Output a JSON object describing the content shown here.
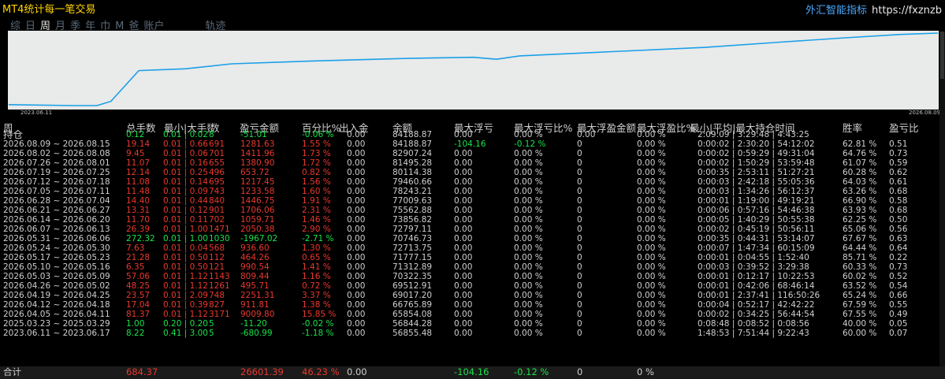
{
  "app": {
    "title": "MT4统计每一笔交易",
    "brand_cn": "外汇智能指标",
    "brand_url": "https://fxznzb"
  },
  "tabs": [
    "综",
    "日",
    "周",
    "月",
    "季",
    "年",
    "巾",
    "M",
    "爸",
    "账户",
    "轨迹"
  ],
  "active_tab": 2,
  "chart": {
    "start_label": "2023.06.11",
    "end_label": "2026.08.09",
    "line_color": "#1aa0e8",
    "points": [
      [
        0,
        54720
      ],
      [
        0.07,
        54300
      ],
      [
        0.095,
        54300
      ],
      [
        0.11,
        56200
      ],
      [
        0.14,
        69800
      ],
      [
        0.19,
        70600
      ],
      [
        0.24,
        72800
      ],
      [
        0.33,
        74100
      ],
      [
        0.43,
        75200
      ],
      [
        0.5,
        75700
      ],
      [
        0.525,
        74800
      ],
      [
        0.55,
        76300
      ],
      [
        0.65,
        78200
      ],
      [
        0.75,
        80100
      ],
      [
        0.83,
        82400
      ],
      [
        0.9,
        84300
      ],
      [
        0.96,
        85800
      ],
      [
        1,
        86400
      ]
    ]
  },
  "headers": [
    "周",
    "总手数",
    "最小|大手数",
    "数",
    "盈亏金额",
    "百分比%",
    "出入金",
    "余额",
    "最大浮亏",
    "最大浮亏比%",
    "最大浮盈金额",
    "最大浮盈比%",
    "最小|平均|最大持仓时间",
    "胜率",
    "盈亏比"
  ],
  "subheader": {
    "label": "持仓",
    "cells": [
      "0.12",
      "0.01 | 0.02",
      "8",
      "-51.01",
      "-0.06 %",
      "0.00",
      "84188.87",
      "0.00",
      "0.00 %",
      "0.00",
      "0.00 %",
      "2:09:09 | 3:29:48 | 4:43:25",
      "",
      ""
    ]
  },
  "rows": [
    {
      "c": "r",
      "v": [
        "2026.08.09 ~ 2026.08.15",
        "19.14",
        "0.01 | 0.66",
        "691",
        "1281.63",
        "1.55 %",
        "0.00",
        "84188.87",
        "-104.16",
        "-0.12 %",
        "0",
        "0.00 %",
        "0:00:02 | 2:30:20 | 54:12:02",
        "62.81 %",
        "0.51"
      ]
    },
    {
      "c": "r",
      "v": [
        "2026.08.02 ~ 2026.08.08",
        "9.45",
        "0.01 | 0.06",
        "701",
        "1411.96",
        "1.73 %",
        "0.00",
        "82907.24",
        "0.00",
        "0.00 %",
        "0",
        "0.00 %",
        "0:00:02 | 0:59:29 | 49:31:04",
        "64.76 %",
        "0.73"
      ]
    },
    {
      "c": "r",
      "v": [
        "2026.07.26 ~ 2026.08.01",
        "11.07",
        "0.01 | 0.16",
        "655",
        "1380.90",
        "1.72 %",
        "0.00",
        "81495.28",
        "0.00",
        "0.00 %",
        "0",
        "0.00 %",
        "0:00:02 | 1:50:29 | 53:59:48",
        "61.07 %",
        "0.59"
      ]
    },
    {
      "c": "r",
      "v": [
        "2026.07.19 ~ 2026.07.25",
        "12.14",
        "0.01 | 0.25",
        "496",
        "653.72",
        "0.82 %",
        "0.00",
        "80114.38",
        "0.00",
        "0.00 %",
        "0",
        "0.00 %",
        "0:00:35 | 2:53:11 | 51:27:21",
        "60.28 %",
        "0.62"
      ]
    },
    {
      "c": "r",
      "v": [
        "2026.07.12 ~ 2026.07.18",
        "11.08",
        "0.01 | 0.14",
        "695",
        "1217.45",
        "1.56 %",
        "0.00",
        "79460.66",
        "0.00",
        "0.00 %",
        "0",
        "0.00 %",
        "0:00:03 | 2:42:18 | 55:05:36",
        "64.03 %",
        "0.61"
      ]
    },
    {
      "c": "r",
      "v": [
        "2026.07.05 ~ 2026.07.11",
        "11.48",
        "0.01 | 0.09",
        "743",
        "1233.58",
        "1.60 %",
        "0.00",
        "78243.21",
        "0.00",
        "0.00 %",
        "0",
        "0.00 %",
        "0:00:03 | 1:34:26 | 56:12:37",
        "63.26 %",
        "0.68"
      ]
    },
    {
      "c": "r",
      "v": [
        "2026.06.28 ~ 2026.07.04",
        "14.40",
        "0.01 | 0.44",
        "840",
        "1446.75",
        "1.91 %",
        "0.00",
        "77009.63",
        "0.00",
        "0.00 %",
        "0",
        "0.00 %",
        "0:00:01 | 1:19:00 | 49:19:21",
        "66.90 %",
        "0.58"
      ]
    },
    {
      "c": "r",
      "v": [
        "2026.06.21 ~ 2026.06.27",
        "13.31",
        "0.01 | 0.12",
        "901",
        "1706.06",
        "2.31 %",
        "0.00",
        "75562.88",
        "0.00",
        "0.00 %",
        "0",
        "0.00 %",
        "0:00:06 | 0:57:16 | 54:46:38",
        "63.93 %",
        "0.68"
      ]
    },
    {
      "c": "r",
      "v": [
        "2026.06.14 ~ 2026.06.20",
        "11.70",
        "0.01 | 0.11",
        "702",
        "1059.71",
        "1.46 %",
        "0.00",
        "73856.82",
        "0.00",
        "0.00 %",
        "0",
        "0.00 %",
        "0:00:05 | 1:40:29 | 50:55:38",
        "62.25 %",
        "0.50"
      ]
    },
    {
      "c": "r",
      "v": [
        "2026.06.07 ~ 2026.06.13",
        "26.39",
        "0.01 | 1.00",
        "1471",
        "2050.38",
        "2.90 %",
        "0.00",
        "72797.11",
        "0.00",
        "0.00 %",
        "0",
        "0.00 %",
        "0:00:02 | 0:45:19 | 50:56:11",
        "65.06 %",
        "0.56"
      ]
    },
    {
      "c": "g",
      "v": [
        "2026.05.31 ~ 2026.06.06",
        "272.32",
        "0.01 | 1.00",
        "1030",
        "-1967.02",
        "-2.71 %",
        "0.00",
        "70746.73",
        "0.00",
        "0.00 %",
        "0",
        "0.00 %",
        "0:00:35 | 0:44:31 | 53:14:07",
        "67.67 %",
        "0.63"
      ]
    },
    {
      "c": "r",
      "v": [
        "2026.05.24 ~ 2026.05.30",
        "7.63",
        "0.01 | 0.04",
        "568",
        "936.60",
        "1.30 %",
        "0.00",
        "72713.75",
        "0.00",
        "0.00 %",
        "0",
        "0.00 %",
        "0:00:07 | 1:47:34 | 60:15:09",
        "64.44 %",
        "0.64"
      ]
    },
    {
      "c": "r",
      "v": [
        "2026.05.17 ~ 2026.05.23",
        "21.28",
        "0.01 | 0.50",
        "112",
        "464.26",
        "0.65 %",
        "0.00",
        "71777.15",
        "0.00",
        "0.00 %",
        "0",
        "0.00 %",
        "0:00:01 | 0:04:55 | 1:52:40",
        "85.71 %",
        "0.22"
      ]
    },
    {
      "c": "r",
      "v": [
        "2026.05.10 ~ 2026.05.16",
        "6.35",
        "0.01 | 0.50",
        "121",
        "990.54",
        "1.41 %",
        "0.00",
        "71312.89",
        "0.00",
        "0.00 %",
        "0",
        "0.00 %",
        "0:00:03 | 0:39:52 | 3:29:38",
        "60.33 %",
        "0.73"
      ]
    },
    {
      "c": "r",
      "v": [
        "2026.05.03 ~ 2026.05.09",
        "57.06",
        "0.01 | 1.12",
        "1143",
        "809.44",
        "1.16 %",
        "0.00",
        "70322.35",
        "0.00",
        "0.00 %",
        "0",
        "0.00 %",
        "0:00:01 | 0:12:17 | 10:22:53",
        "60.02 %",
        "0.52"
      ]
    },
    {
      "c": "r",
      "v": [
        "2026.04.26 ~ 2026.05.02",
        "48.25",
        "0.01 | 1.12",
        "1261",
        "495.71",
        "0.72 %",
        "0.00",
        "69512.91",
        "0.00",
        "0.00 %",
        "0",
        "0.00 %",
        "0:00:01 | 0:42:06 | 68:46:14",
        "63.52 %",
        "0.54"
      ]
    },
    {
      "c": "r",
      "v": [
        "2026.04.19 ~ 2026.04.25",
        "23.57",
        "0.01 | 2.09",
        "748",
        "2251.31",
        "3.37 %",
        "0.00",
        "69017.20",
        "0.00",
        "0.00 %",
        "0",
        "0.00 %",
        "0:00:01 | 2:37:41 | 116:50:26",
        "65.24 %",
        "0.66"
      ]
    },
    {
      "c": "r",
      "v": [
        "2026.04.12 ~ 2026.04.18",
        "17.04",
        "0.01 | 0.39",
        "827",
        "911.81",
        "1.38 %",
        "0.00",
        "66765.89",
        "0.00",
        "0.00 %",
        "0",
        "0.00 %",
        "0:00:04 | 0:52:17 | 42:42:22",
        "67.59 %",
        "0.55"
      ]
    },
    {
      "c": "r",
      "v": [
        "2026.04.05 ~ 2026.04.11",
        "81.37",
        "0.01 | 1.12",
        "3171",
        "9009.80",
        "15.85 %",
        "0.00",
        "65854.08",
        "0.00",
        "0.00 %",
        "0",
        "0.00 %",
        "0:00:02 | 0:34:25 | 56:44:54",
        "67.55 %",
        "0.49"
      ]
    },
    {
      "c": "g",
      "v": [
        "2025.03.23 ~ 2025.03.29",
        "1.00",
        "0.20 | 0.20",
        "5",
        "-11.20",
        "-0.02 %",
        "0.00",
        "56844.28",
        "0.00",
        "0.00 %",
        "0",
        "0.00 %",
        "0:08:48 | 0:08:52 | 0:08:56",
        "40.00 %",
        "0.05"
      ]
    },
    {
      "c": "g",
      "v": [
        "2023.06.11 ~ 2023.06.17",
        "8.22",
        "0.41 | 3.00",
        "5",
        "-680.99",
        "-1.18 %",
        "0.00",
        "56855.48",
        "0.00",
        "0.00 %",
        "0",
        "0.00 %",
        "1:48:53 | 7:51:44 | 9:22:43",
        "60.00 %",
        "0.07"
      ]
    }
  ],
  "total": {
    "label": "合计",
    "lots": "684.37",
    "pnl": "26601.39",
    "pct": "46.23 %",
    "inout": "0.00",
    "max_float_loss": "-104.16",
    "max_float_loss_pct": "-0.12 %",
    "max_float_profit": "0",
    "max_float_profit_pct": "0 %"
  },
  "colors": {
    "red": "#e8382d",
    "green": "#19e24a",
    "title": "#ffd400",
    "brand": "#4aa8ff"
  }
}
